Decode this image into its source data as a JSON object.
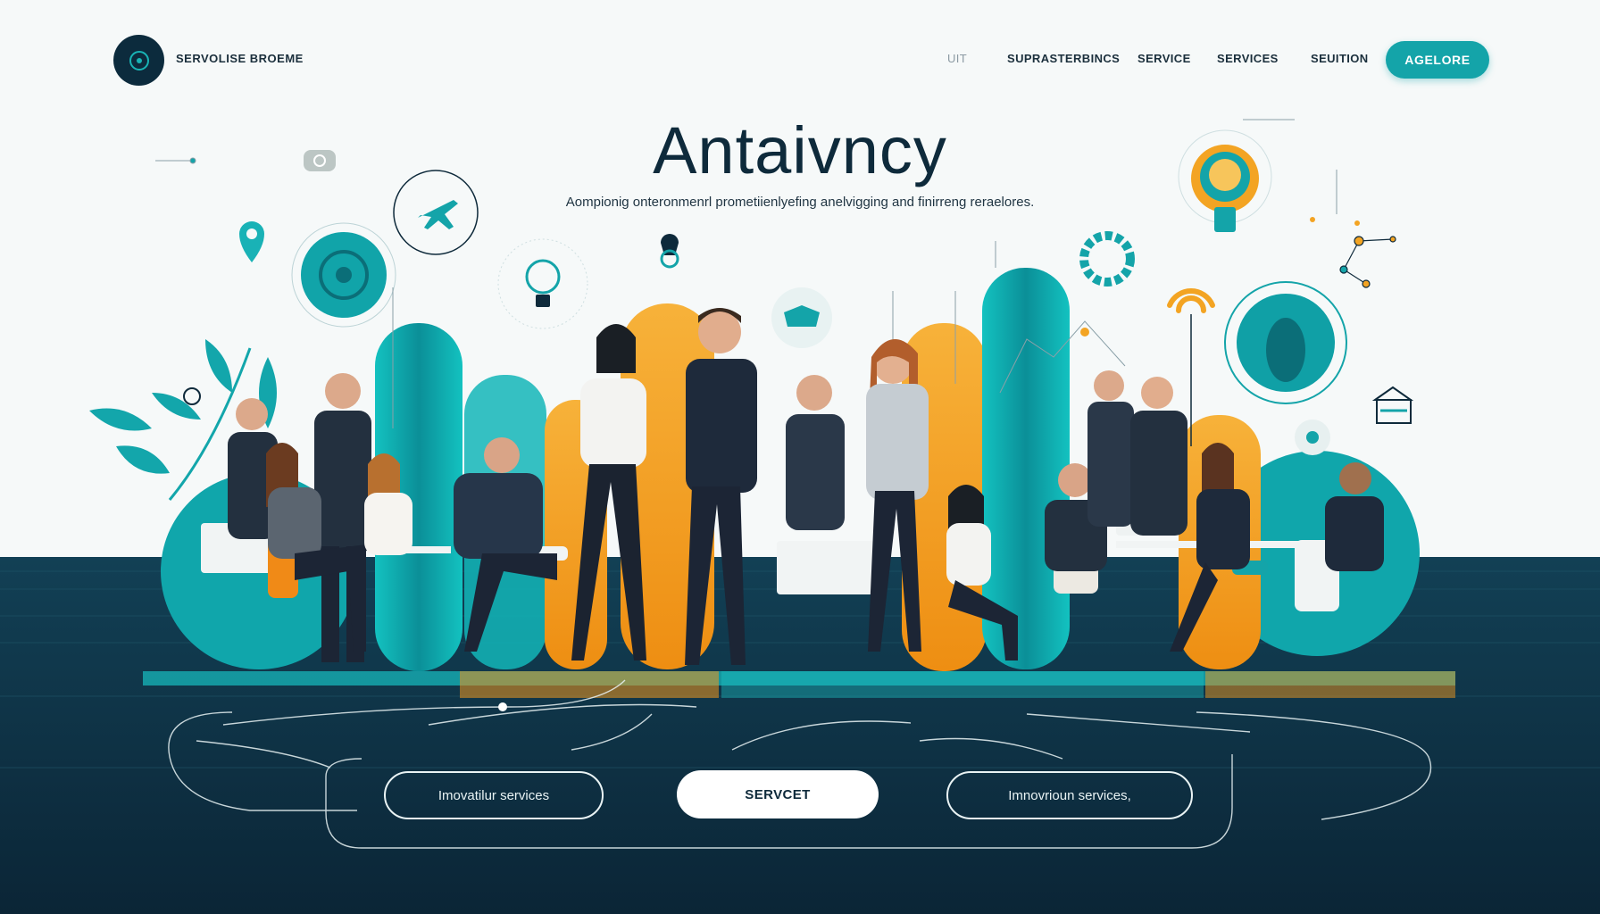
{
  "header": {
    "brand": "SERVOLISE BROEME",
    "nav": [
      "UIT",
      "SUPRASTERBINCS",
      "SERVICE",
      "SERVICES",
      "SEUITION"
    ],
    "cta": "AGELORE"
  },
  "hero": {
    "title": "Antaivncy",
    "subtitle": "Aompionig onteronmenrl prometiienlyefing anelvigging and finirreng reraelores."
  },
  "actions": {
    "left": "Imovatilur services",
    "center": "SERVCET",
    "right": "Imnovrioun services,"
  },
  "colors": {
    "teal": "#14a4a9",
    "navy": "#0c2b3d",
    "orange": "#f3a423",
    "background": "#f6f9f9"
  },
  "icons": [
    "logo-icon",
    "map-pin-icon",
    "gear-icon",
    "airplane-icon",
    "lightbulb-icon",
    "tray-icon",
    "wifi-icon",
    "network-icon",
    "monitor-icon",
    "chat-bubble-icon"
  ]
}
